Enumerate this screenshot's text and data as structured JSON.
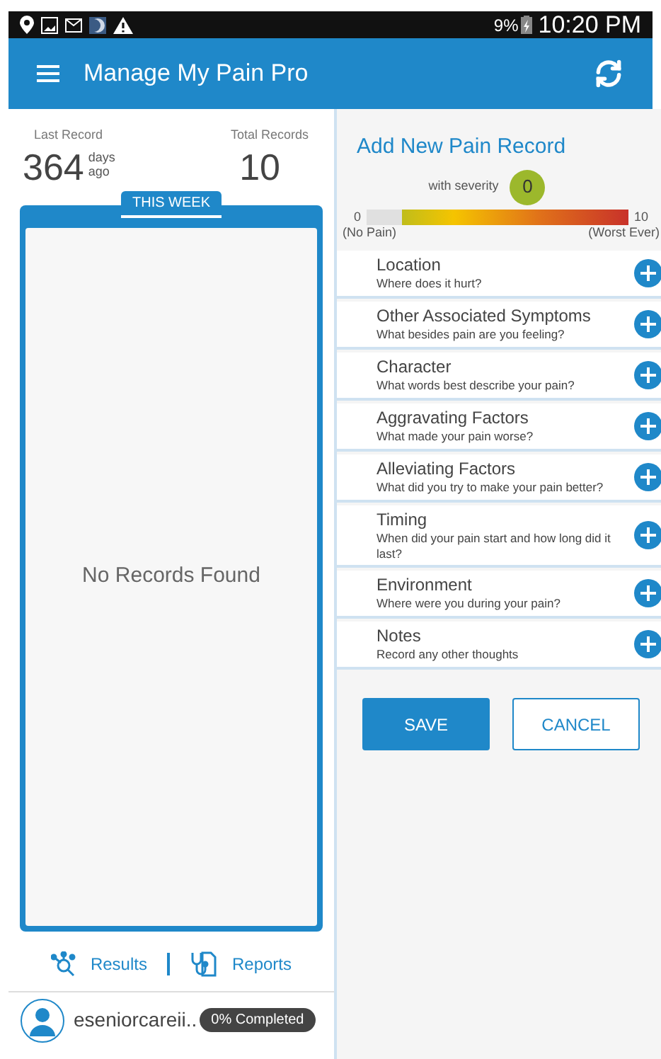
{
  "status_bar": {
    "battery": "9%",
    "time": "10:20 PM"
  },
  "app_bar": {
    "title": "Manage My Pain Pro"
  },
  "summary": {
    "last_label": "Last Record",
    "last_value": "364",
    "last_unit_top": "days",
    "last_unit_bottom": "ago",
    "total_label": "Total Records",
    "total_value": "10"
  },
  "week": {
    "tab": "THIS WEEK",
    "empty": "No Records Found"
  },
  "links": [
    "Results",
    "Reports"
  ],
  "profile": {
    "name": "eseniorcareii..",
    "progress": "0% Completed"
  },
  "form": {
    "title": "Add New Pain Record",
    "severity_label": "with severity",
    "severity_value": "0",
    "scale_min": "0",
    "scale_max": "10",
    "scale_min_label": "(No Pain)",
    "scale_max_label": "(Worst Ever)",
    "level": 0,
    "sections": [
      {
        "title": "Location",
        "hint": "Where does it hurt?"
      },
      {
        "title": "Other Associated Symptoms",
        "hint": "What besides pain are you feeling?"
      },
      {
        "title": "Character",
        "hint": "What words best describe your pain?"
      },
      {
        "title": "Aggravating Factors",
        "hint": "What made your pain worse?"
      },
      {
        "title": "Alleviating Factors",
        "hint": "What did you try to make your pain better?"
      },
      {
        "title": "Timing",
        "hint": "When did your pain start and how long did it last?"
      },
      {
        "title": "Environment",
        "hint": "Where were you during your pain?"
      },
      {
        "title": "Notes",
        "hint": "Record any other thoughts"
      }
    ],
    "buttons": [
      "SAVE",
      "CANCEL"
    ]
  }
}
